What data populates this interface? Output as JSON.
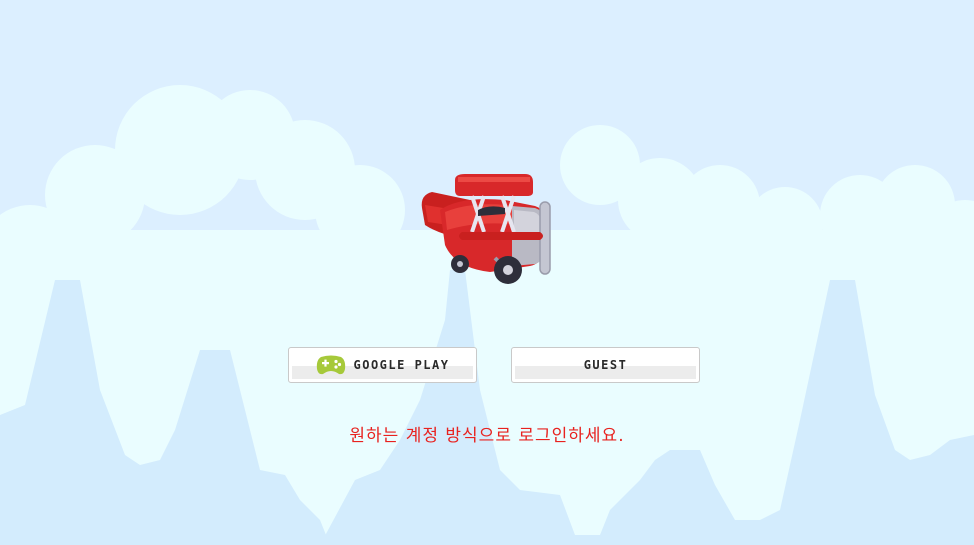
{
  "buttons": {
    "google_play_label": "GOOGLE PLAY",
    "guest_label": "GUEST"
  },
  "message": "원하는 계정 방식으로 로그인하세요.",
  "icons": {
    "google_play": "gamepad-icon",
    "character": "biplane-icon"
  },
  "colors": {
    "sky": "#dcefff",
    "cloud": "#eafdff",
    "far_cloud": "#d3ecfd",
    "message": "#e8221f",
    "plane": "#d8282a",
    "gamepad": "#a6c93a"
  }
}
